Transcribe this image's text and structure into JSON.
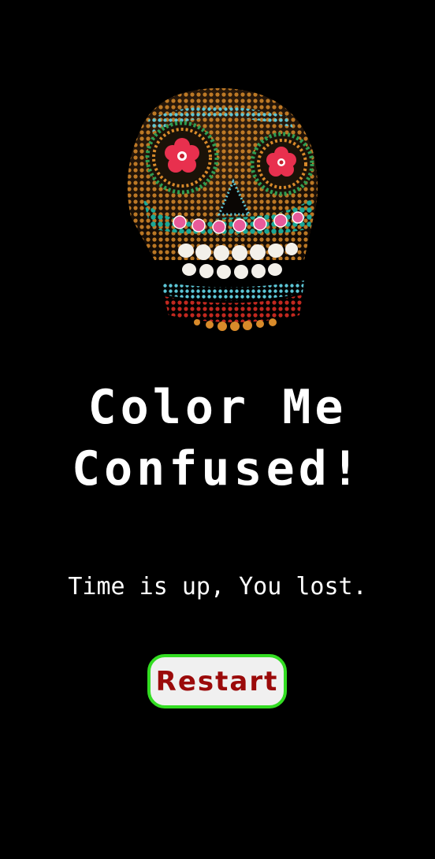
{
  "app": {
    "background_color": "#000000"
  },
  "hero": {
    "image_icon": "sugar-skull-illustration"
  },
  "title": {
    "line1": "Color Me",
    "line2": "Confused!"
  },
  "status": {
    "message": "Time is up, You lost."
  },
  "actions": {
    "restart_label": "Restart",
    "restart_border_color": "#33dd22",
    "restart_text_color": "#9b0a0a"
  }
}
